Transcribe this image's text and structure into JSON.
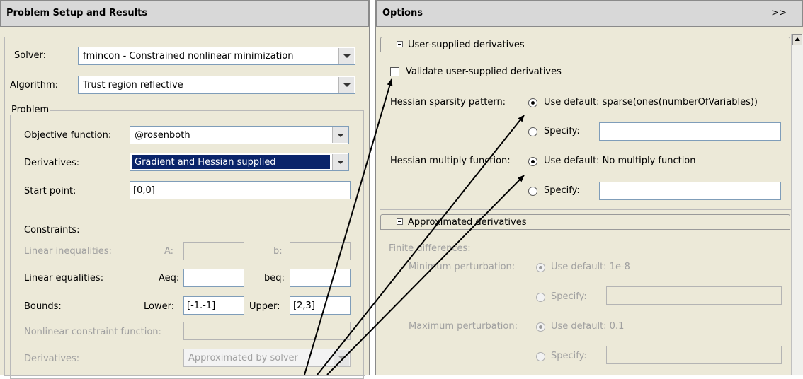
{
  "left": {
    "header": "Problem Setup and Results",
    "solver": {
      "label": "Solver:",
      "value": "fmincon - Constrained nonlinear minimization"
    },
    "algorithm": {
      "label": "Algorithm:",
      "value": "Trust region reflective"
    },
    "problem": {
      "title": "Problem",
      "objective": {
        "label": "Objective function:",
        "value": "@rosenboth"
      },
      "derivatives": {
        "label": "Derivatives:",
        "value": "Gradient and Hessian supplied"
      },
      "start_point": {
        "label": "Start point:",
        "value": "[0,0]"
      }
    },
    "constraints": {
      "title": "Constraints:",
      "linear_ineq": {
        "label": "Linear inequalities:",
        "a_label": "A:",
        "a_value": "",
        "b_label": "b:",
        "b_value": ""
      },
      "linear_eq": {
        "label": "Linear equalities:",
        "aeq_label": "Aeq:",
        "aeq_value": "",
        "beq_label": "beq:",
        "beq_value": ""
      },
      "bounds": {
        "label": "Bounds:",
        "lower_label": "Lower:",
        "lower_value": "[-1.-1]",
        "upper_label": "Upper:",
        "upper_value": "[2,3]"
      },
      "nonlinear": {
        "label": "Nonlinear constraint function:",
        "value": ""
      },
      "derivatives": {
        "label": "Derivatives:",
        "value": "Approximated by solver"
      }
    }
  },
  "right": {
    "header": "Options",
    "expand_label": ">>",
    "user_supplied": {
      "title": "User-supplied derivatives",
      "validate_label": "Validate user-supplied derivatives",
      "hessian_sparsity": {
        "label": "Hessian sparsity pattern:",
        "default_label": "Use default: sparse(ones(numberOfVariables))",
        "specify_label": "Specify:",
        "specify_value": ""
      },
      "hessian_multiply": {
        "label": "Hessian multiply function:",
        "default_label": "Use default: No multiply function",
        "specify_label": "Specify:",
        "specify_value": ""
      }
    },
    "approximated": {
      "title": "Approximated derivatives",
      "finite_differences": "Finite differences:",
      "min_perturbation": {
        "label": "Minimum perturbation:",
        "default_label": "Use default: 1e-8",
        "specify_label": "Specify:",
        "specify_value": ""
      },
      "max_perturbation": {
        "label": "Maximum perturbation:",
        "default_label": "Use default: 0.1",
        "specify_label": "Specify:",
        "specify_value": ""
      }
    }
  },
  "colors": {
    "panel": "#ece9d8",
    "header": "#d8d8d8",
    "selection": "#0a246a",
    "arrow": "#000000"
  }
}
